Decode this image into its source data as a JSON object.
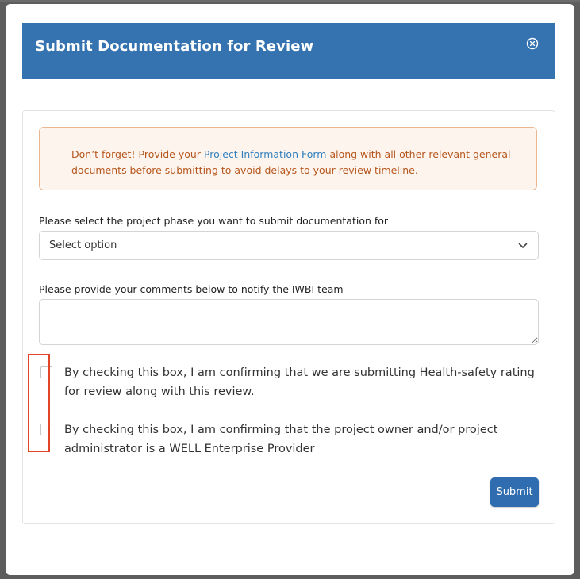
{
  "modal": {
    "title": "Submit Documentation for Review",
    "close_icon": "close-circle-icon"
  },
  "alert": {
    "text_before": "Don’t forget! Provide your ",
    "link_text": "Project Information Form",
    "text_after": " along with all other relevant general documents before submitting to avoid delays to your review timeline."
  },
  "phase": {
    "label": "Please select the project phase you want to submit documentation for",
    "selected": "Select option"
  },
  "comments": {
    "label": "Please provide your comments below to notify the IWBI team",
    "value": ""
  },
  "checkboxes": [
    {
      "label": "By checking this box, I am confirming that we are submitting Health-safety rating for review along with this review.",
      "checked": false
    },
    {
      "label": "By checking this box, I am confirming that the project owner and/or project administrator is a WELL Enterprise Provider",
      "checked": false
    }
  ],
  "submit_label": "Submit",
  "colors": {
    "header": "#3572b0",
    "alert_text": "#b6561c",
    "alert_border": "#e8b690",
    "alert_bg": "#fdf4ee",
    "link": "#2f7fbf",
    "submit": "#2f6db0",
    "highlight": "#e2442a"
  }
}
